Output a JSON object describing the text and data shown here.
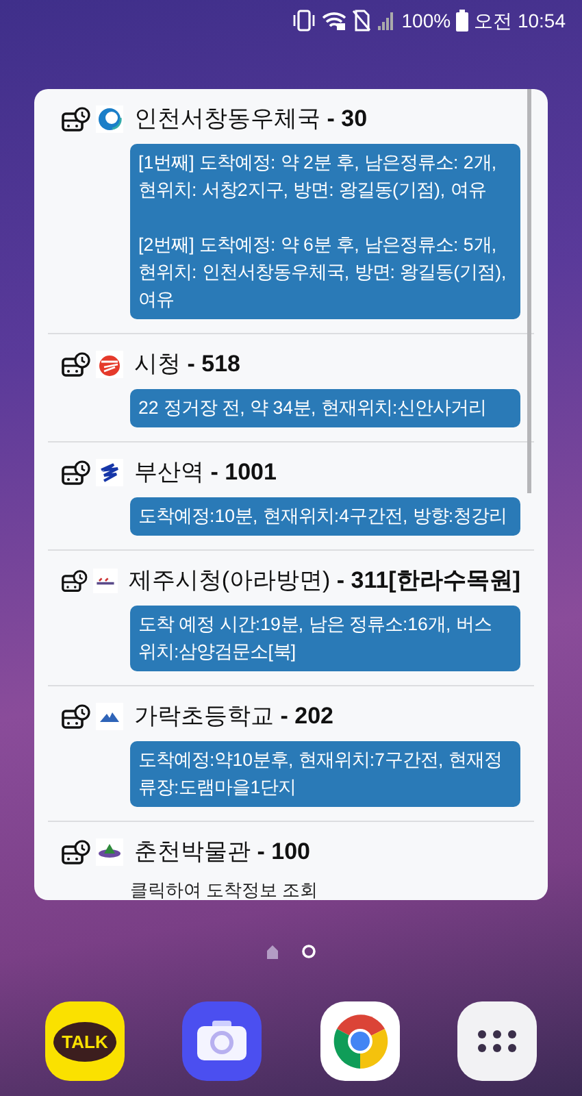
{
  "status_bar": {
    "battery_text": "100%",
    "time": "오전 10:54"
  },
  "widget": {
    "stops": [
      {
        "kind": "info",
        "title": "인천서창동우체국 **- 30**",
        "info": [
          "[1번째] 도착예정: 약 2분 후, 남은정류소: 2개, 현위치: 서창2지구, 방면: 왕길동(기점), 여유",
          "[2번째] 도착예정: 약 6분 후, 남은정류소: 5개, 현위치: 인천서창동우체국, 방면: 왕길동(기점), 여유"
        ]
      },
      {
        "kind": "info",
        "title": "시청 **- 518**",
        "info": [
          "22 정거장 전, 약 34분, 현재위치:신안사거리"
        ]
      },
      {
        "kind": "info",
        "title": "부산역 **- 1001**",
        "info": [
          "도착예정:10분, 현재위치:4구간전, 방향:청강리"
        ]
      },
      {
        "kind": "info",
        "title": "제주시청(아라방면) **- 311[한라수목원]**",
        "info": [
          "도착 예정 시간:19분, 남은 정류소:16개, 버스 위치:삼양검문소[북]"
        ]
      },
      {
        "kind": "info",
        "title": "가락초등학교 **- 202**",
        "info": [
          "도착예정:약10분후, 현재위치:7구간전, 현재정류장:도램마을1단지"
        ]
      },
      {
        "kind": "hint",
        "title": "춘천박물관 **- 100**",
        "info": [
          "클릭하여 도착정보 조회"
        ]
      }
    ]
  },
  "page_indicator": [
    {
      "kind": "home",
      "selected": false
    },
    {
      "kind": "page",
      "selected": true
    }
  ],
  "dock": [
    {
      "kind": "talk",
      "label": "TALK"
    },
    {
      "kind": "camera"
    },
    {
      "kind": "browser"
    },
    {
      "kind": "apps"
    }
  ]
}
